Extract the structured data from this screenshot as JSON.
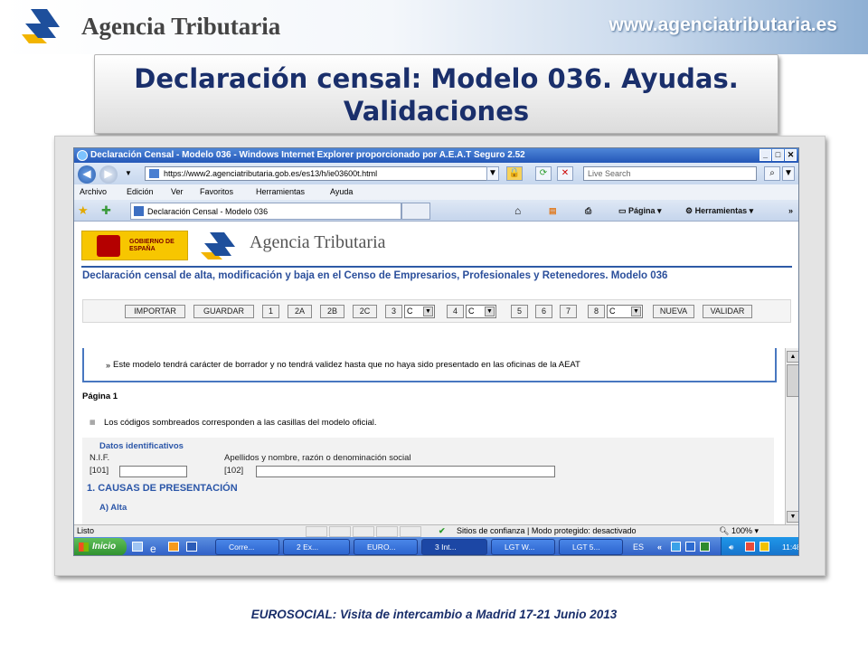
{
  "slide": {
    "brand": "Agencia Tributaria",
    "website": "www.agenciatributaria.es",
    "title_line1": "Declaración censal: Modelo 036. Ayudas.",
    "title_line2": "Validaciones",
    "footer": "EUROSOCIAL: Visita de intercambio a Madrid 17-21 Junio 2013"
  },
  "browser": {
    "window_title": "Declaración Censal - Modelo 036 - Windows Internet Explorer proporcionado por A.E.A.T Seguro 2.52",
    "window_buttons": [
      "_",
      "□",
      "✕"
    ],
    "address": "https://www2.agenciatributaria.gob.es/es13/h/ie03600t.html",
    "search_placeholder": "Live Search",
    "menu": [
      "Archivo",
      "Edición",
      "Ver",
      "Favoritos",
      "Herramientas",
      "Ayuda"
    ],
    "tab_title": "Declaración Censal - Modelo 036",
    "toolbar": {
      "pagina": "Página",
      "herramientas": "Herramientas"
    }
  },
  "page": {
    "gov_logo_text": "GOBIERNO DE ESPAÑA",
    "agency_name": "Agencia Tributaria",
    "heading": "Declaración censal de alta, modificación y baja en el Censo de Empresarios, Profesionales y Retenedores. Modelo 036",
    "buttons": [
      "IMPORTAR",
      "GUARDAR",
      "1",
      "2A",
      "2B",
      "2C",
      "3",
      "4",
      "5",
      "6",
      "7",
      "8",
      "NUEVA",
      "VALIDAR"
    ],
    "select_value": "C",
    "notice": "Este modelo tendrá carácter de borrador y no tendrá validez hasta que no haya sido presentado en las oficinas de la AEAT",
    "pagina_label": "Página 1",
    "hint": "Los códigos sombreados corresponden a las casillas del modelo oficial.",
    "section_datos": "Datos identificativos",
    "nif_label": "N.I.F.",
    "name_label": "Apellidos y nombre, razón o denominación social",
    "code_101": "[101]",
    "code_102": "[102]",
    "section_causas": "1. CAUSAS DE PRESENTACIÓN",
    "section_alta": "A) Alta"
  },
  "status": {
    "left": "Listo",
    "zone": "Sitios de confianza | Modo protegido: desactivado",
    "zoom": "100%"
  },
  "taskbar": {
    "start": "Inicio",
    "items": [
      "Corre...",
      "2 Ex...",
      "EURO...",
      "3 Int...",
      "LGT W...",
      "LGT 5..."
    ],
    "lang": "ES",
    "clock": "11:48"
  }
}
